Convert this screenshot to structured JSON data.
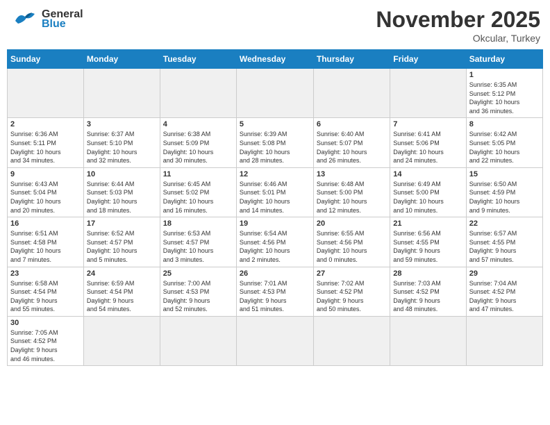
{
  "header": {
    "logo_general": "General",
    "logo_blue": "Blue",
    "month": "November 2025",
    "location": "Okcular, Turkey"
  },
  "days_of_week": [
    "Sunday",
    "Monday",
    "Tuesday",
    "Wednesday",
    "Thursday",
    "Friday",
    "Saturday"
  ],
  "weeks": [
    [
      {
        "day": "",
        "info": ""
      },
      {
        "day": "",
        "info": ""
      },
      {
        "day": "",
        "info": ""
      },
      {
        "day": "",
        "info": ""
      },
      {
        "day": "",
        "info": ""
      },
      {
        "day": "",
        "info": ""
      },
      {
        "day": "1",
        "info": "Sunrise: 6:35 AM\nSunset: 5:12 PM\nDaylight: 10 hours\nand 36 minutes."
      }
    ],
    [
      {
        "day": "2",
        "info": "Sunrise: 6:36 AM\nSunset: 5:11 PM\nDaylight: 10 hours\nand 34 minutes."
      },
      {
        "day": "3",
        "info": "Sunrise: 6:37 AM\nSunset: 5:10 PM\nDaylight: 10 hours\nand 32 minutes."
      },
      {
        "day": "4",
        "info": "Sunrise: 6:38 AM\nSunset: 5:09 PM\nDaylight: 10 hours\nand 30 minutes."
      },
      {
        "day": "5",
        "info": "Sunrise: 6:39 AM\nSunset: 5:08 PM\nDaylight: 10 hours\nand 28 minutes."
      },
      {
        "day": "6",
        "info": "Sunrise: 6:40 AM\nSunset: 5:07 PM\nDaylight: 10 hours\nand 26 minutes."
      },
      {
        "day": "7",
        "info": "Sunrise: 6:41 AM\nSunset: 5:06 PM\nDaylight: 10 hours\nand 24 minutes."
      },
      {
        "day": "8",
        "info": "Sunrise: 6:42 AM\nSunset: 5:05 PM\nDaylight: 10 hours\nand 22 minutes."
      }
    ],
    [
      {
        "day": "9",
        "info": "Sunrise: 6:43 AM\nSunset: 5:04 PM\nDaylight: 10 hours\nand 20 minutes."
      },
      {
        "day": "10",
        "info": "Sunrise: 6:44 AM\nSunset: 5:03 PM\nDaylight: 10 hours\nand 18 minutes."
      },
      {
        "day": "11",
        "info": "Sunrise: 6:45 AM\nSunset: 5:02 PM\nDaylight: 10 hours\nand 16 minutes."
      },
      {
        "day": "12",
        "info": "Sunrise: 6:46 AM\nSunset: 5:01 PM\nDaylight: 10 hours\nand 14 minutes."
      },
      {
        "day": "13",
        "info": "Sunrise: 6:48 AM\nSunset: 5:00 PM\nDaylight: 10 hours\nand 12 minutes."
      },
      {
        "day": "14",
        "info": "Sunrise: 6:49 AM\nSunset: 5:00 PM\nDaylight: 10 hours\nand 10 minutes."
      },
      {
        "day": "15",
        "info": "Sunrise: 6:50 AM\nSunset: 4:59 PM\nDaylight: 10 hours\nand 9 minutes."
      }
    ],
    [
      {
        "day": "16",
        "info": "Sunrise: 6:51 AM\nSunset: 4:58 PM\nDaylight: 10 hours\nand 7 minutes."
      },
      {
        "day": "17",
        "info": "Sunrise: 6:52 AM\nSunset: 4:57 PM\nDaylight: 10 hours\nand 5 minutes."
      },
      {
        "day": "18",
        "info": "Sunrise: 6:53 AM\nSunset: 4:57 PM\nDaylight: 10 hours\nand 3 minutes."
      },
      {
        "day": "19",
        "info": "Sunrise: 6:54 AM\nSunset: 4:56 PM\nDaylight: 10 hours\nand 2 minutes."
      },
      {
        "day": "20",
        "info": "Sunrise: 6:55 AM\nSunset: 4:56 PM\nDaylight: 10 hours\nand 0 minutes."
      },
      {
        "day": "21",
        "info": "Sunrise: 6:56 AM\nSunset: 4:55 PM\nDaylight: 9 hours\nand 59 minutes."
      },
      {
        "day": "22",
        "info": "Sunrise: 6:57 AM\nSunset: 4:55 PM\nDaylight: 9 hours\nand 57 minutes."
      }
    ],
    [
      {
        "day": "23",
        "info": "Sunrise: 6:58 AM\nSunset: 4:54 PM\nDaylight: 9 hours\nand 55 minutes."
      },
      {
        "day": "24",
        "info": "Sunrise: 6:59 AM\nSunset: 4:54 PM\nDaylight: 9 hours\nand 54 minutes."
      },
      {
        "day": "25",
        "info": "Sunrise: 7:00 AM\nSunset: 4:53 PM\nDaylight: 9 hours\nand 52 minutes."
      },
      {
        "day": "26",
        "info": "Sunrise: 7:01 AM\nSunset: 4:53 PM\nDaylight: 9 hours\nand 51 minutes."
      },
      {
        "day": "27",
        "info": "Sunrise: 7:02 AM\nSunset: 4:52 PM\nDaylight: 9 hours\nand 50 minutes."
      },
      {
        "day": "28",
        "info": "Sunrise: 7:03 AM\nSunset: 4:52 PM\nDaylight: 9 hours\nand 48 minutes."
      },
      {
        "day": "29",
        "info": "Sunrise: 7:04 AM\nSunset: 4:52 PM\nDaylight: 9 hours\nand 47 minutes."
      }
    ],
    [
      {
        "day": "30",
        "info": "Sunrise: 7:05 AM\nSunset: 4:52 PM\nDaylight: 9 hours\nand 46 minutes."
      },
      {
        "day": "",
        "info": ""
      },
      {
        "day": "",
        "info": ""
      },
      {
        "day": "",
        "info": ""
      },
      {
        "day": "",
        "info": ""
      },
      {
        "day": "",
        "info": ""
      },
      {
        "day": "",
        "info": ""
      }
    ]
  ]
}
